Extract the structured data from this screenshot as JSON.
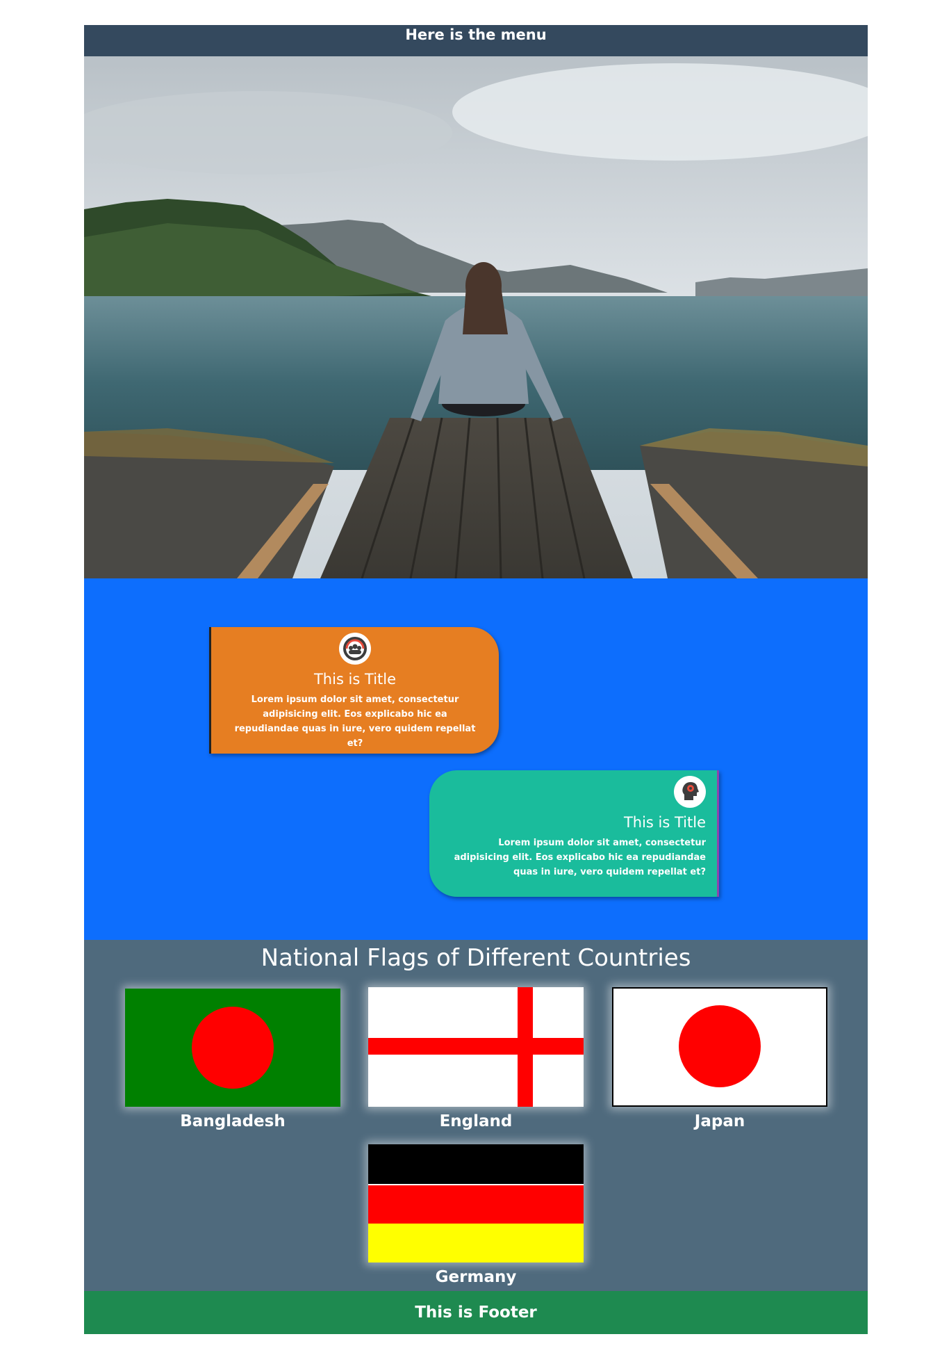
{
  "menu": {
    "label": "Here is the menu"
  },
  "timeline": {
    "cards": [
      {
        "icon": "team-cycle-icon",
        "title": "This is Title",
        "text": "Lorem ipsum dolor sit amet, consectetur adipisicing elit. Eos explicabo hic ea repudiandae quas in iure, vero quidem repellat et?"
      },
      {
        "icon": "head-gear-icon",
        "title": "This is Title",
        "text": "Lorem ipsum dolor sit amet, consectetur adipisicing elit. Eos explicabo hic ea repudiandae quas in iure, vero quidem repellat et?"
      }
    ]
  },
  "flags": {
    "title": "National Flags of Different Countries",
    "items": [
      {
        "label": "Bangladesh"
      },
      {
        "label": "England"
      },
      {
        "label": "Japan"
      },
      {
        "label": "Germany"
      }
    ]
  },
  "footer": {
    "label": "This is Footer"
  },
  "colors": {
    "menu_bg": "#34495e",
    "timeline_bg": "#0d6efd",
    "card_orange": "#e67e22",
    "card_teal": "#1abc9c",
    "flags_bg": "#4f6a7d",
    "footer_bg": "#1e8a50"
  }
}
